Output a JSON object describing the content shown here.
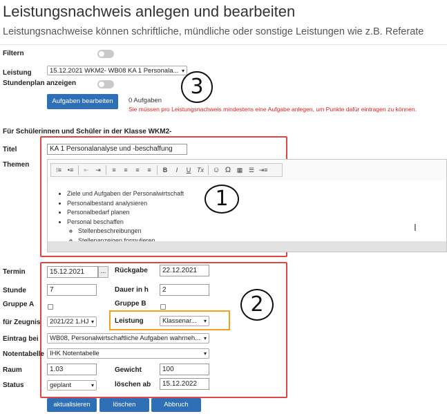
{
  "page": {
    "title": "Leistungsnachweis anlegen und bearbeiten",
    "subtitle": "Leistungsnachweise können schriftliche, mündliche oder sonstige Leistungen wie z.B. Referate"
  },
  "filter": {
    "label": "Filtern"
  },
  "leistung_select": {
    "label": "Leistung",
    "value": "15.12.2021 WKM2- WB08 KA 1 Personala..."
  },
  "stundenplan": {
    "label": "Stundenplan anzeigen"
  },
  "aufgaben": {
    "button_label": "Aufgaben bearbeiten",
    "count": "0 Aufgaben",
    "warning": "Sie müssen pro Leistungsnachweis mindestens eine Aufgabe anlegen, um Punkte dafür eintragen zu können."
  },
  "section_heading": "Für Schülerinnen und Schüler in der Klasse WKM2-",
  "titel": {
    "label": "Titel",
    "value": "KA 1 Personalanalyse und -beschaffung"
  },
  "themen": {
    "label": "Themen",
    "items": [
      "Ziele und Aufgaben der Personalwirtschaft",
      "Personalbestand analysieren",
      "Personalbedarf planen",
      "Personal beschaffen"
    ],
    "subitems": [
      "Stellenbeschreibungen",
      "Stellenanzeigen formulieren"
    ]
  },
  "toolbar": {
    "bold": "B",
    "italic": "I",
    "underline": "U",
    "clear": "Tx",
    "smiley": "☺",
    "omega": "Ω"
  },
  "termin": {
    "label": "Termin",
    "value": "15.12.2021",
    "picker": "..."
  },
  "rueckgabe": {
    "label": "Rückgabe",
    "value": "22.12.2021"
  },
  "stunde": {
    "label": "Stunde",
    "value": "7"
  },
  "dauer": {
    "label": "Dauer in h",
    "value": "2"
  },
  "gruppe_a": {
    "label": "Gruppe A"
  },
  "gruppe_b": {
    "label": "Gruppe B"
  },
  "zeugnis": {
    "label": "für Zeugnis",
    "value": "2021/22 1.HJ"
  },
  "leistung_art": {
    "label": "Leistung",
    "value": "Klassenar..."
  },
  "eintrag": {
    "label": "Eintrag bei",
    "value": "WB08, Personalwirtschaftliche Aufgaben wahrneh..."
  },
  "notentabelle": {
    "label": "Notentabelle",
    "value": "IHK Notentabelle"
  },
  "raum": {
    "label": "Raum",
    "value": "1.03"
  },
  "gewicht": {
    "label": "Gewicht",
    "value": "100"
  },
  "status": {
    "label": "Status",
    "value": "geplant"
  },
  "loeschen_ab": {
    "label": "löschen ab",
    "value": "15.12.2022"
  },
  "actions": {
    "update": "aktualisieren",
    "delete": "löschen",
    "cancel": "Abbruch"
  },
  "annotations": {
    "one": "1",
    "two": "2",
    "three": "3"
  },
  "colors": {
    "accent": "#2f6fb5",
    "warning": "#e02020",
    "highlight_red": "#e04545",
    "highlight_orange": "#f0a21a"
  },
  "icons": [
    "ordered-list-icon",
    "bullet-list-icon",
    "outdent-icon",
    "indent-icon",
    "align-left-icon",
    "align-center-icon",
    "align-right-icon",
    "justify-icon",
    "bold-icon",
    "italic-icon",
    "underline-icon",
    "clear-format-icon",
    "smiley-icon",
    "omega-icon",
    "table-icon",
    "horizontal-rule-icon",
    "insert-icon",
    "text-cursor-icon"
  ]
}
